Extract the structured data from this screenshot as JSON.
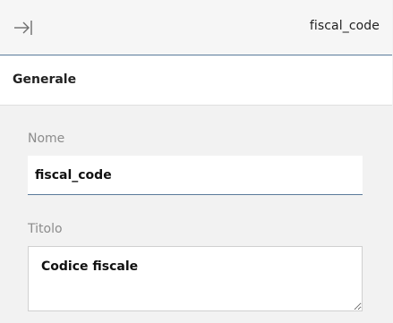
{
  "header": {
    "title": "fiscal_code",
    "collapse_icon": "collapse-panel-right-icon"
  },
  "tabs": [
    {
      "label": "Generale",
      "active": true
    }
  ],
  "form": {
    "name_label": "Nome",
    "name_value": "fiscal_code",
    "title_label": "Titolo",
    "title_value": "Codice fiscale"
  },
  "colors": {
    "accent": "#5a7a9a",
    "background": "#f2f2f2",
    "label": "#8c8c8c"
  }
}
